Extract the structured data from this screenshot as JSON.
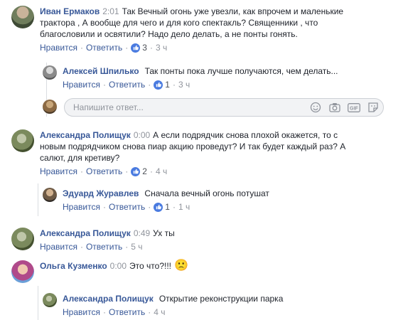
{
  "comments": [
    {
      "author": "Иван Ермаков",
      "time": "2:01",
      "text_lines": [
        "Так Вечный огонь уже увезли, как впрочем и маленькие",
        "трактора , А вообще для чего и для кого спектакль? Священники , что",
        "благословили и освятили? Надо дело делать, а не понты гонять."
      ],
      "like_label": "Нравится",
      "reply_label": "Ответить",
      "reaction_count": "3",
      "age": "3 ч",
      "replies": [
        {
          "author": "Алексей Шпилько",
          "text": "Так понты пока лучше получаются, чем делать...",
          "like_label": "Нравится",
          "reply_label": "Ответить",
          "reaction_count": "1",
          "age": "3 ч"
        }
      ]
    },
    {
      "author": "Александра Полищук",
      "time": "0:00",
      "text_lines": [
        "А если подрядчик снова плохой окажется, то с",
        "новым подрядчиком снова пиар акцию проведут? И так будет каждый раз? А",
        "салют, для кретиву?"
      ],
      "like_label": "Нравится",
      "reply_label": "Ответить",
      "reaction_count": "2",
      "age": "4 ч",
      "replies": [
        {
          "author": "Эдуард Журавлев",
          "text": "Сначала вечный огонь потушат",
          "like_label": "Нравится",
          "reply_label": "Ответить",
          "reaction_count": "1",
          "age": "1 ч"
        }
      ]
    },
    {
      "author": "Александра Полищук",
      "time": "0:49",
      "text_lines": [
        "Ух ты"
      ],
      "like_label": "Нравится",
      "reply_label": "Ответить",
      "age": "5 ч"
    },
    {
      "author": "Ольга Кузменко",
      "time": "0:00",
      "text_lines": [
        "Это что?!!!"
      ],
      "emoji": "🙁",
      "replies": [
        {
          "author": "Александра Полищук",
          "text": "Открытие реконструкции парка",
          "like_label": "Нравится",
          "reply_label": "Ответить",
          "age": "4 ч"
        }
      ]
    }
  ],
  "reply_box": {
    "placeholder": "Напишите ответ..."
  },
  "colors": {
    "author": "#385898",
    "meta": "#90949c",
    "like_badge": "#4a7be0",
    "reply_box_bg": "#f2f3f5"
  }
}
